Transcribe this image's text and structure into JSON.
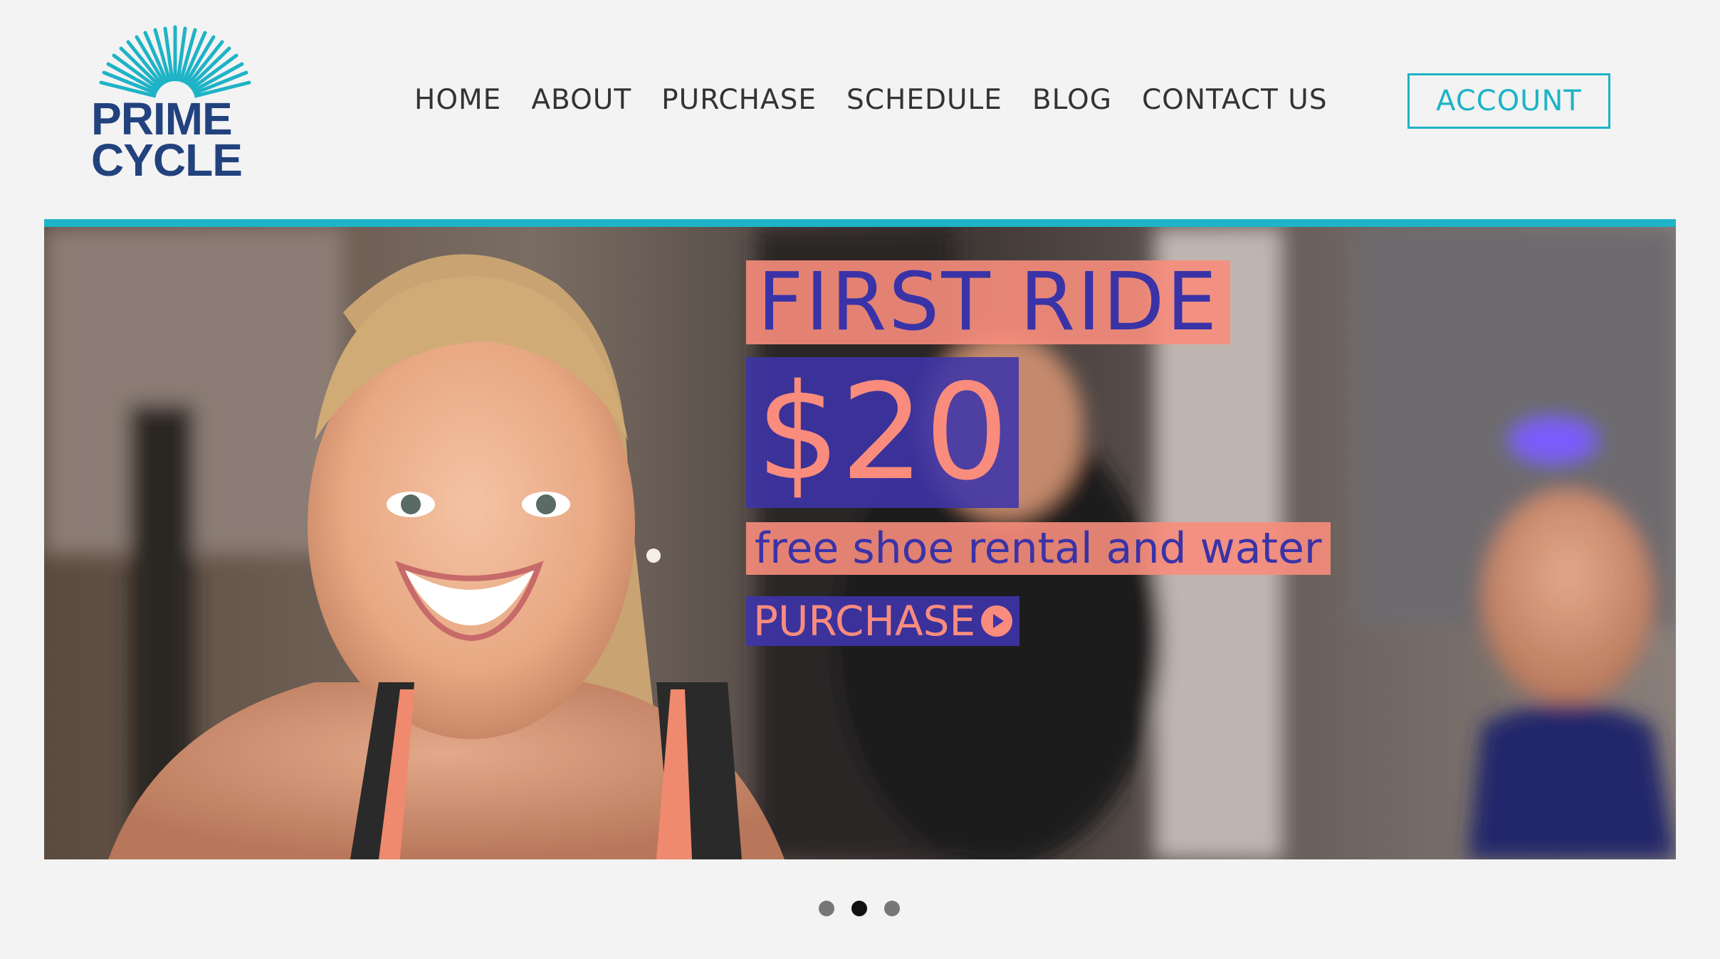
{
  "brand": {
    "logo_line1": "PRIME",
    "logo_line2": "CYCLE",
    "logo_color": "#22427e",
    "accent_color": "#1eb3c6"
  },
  "nav": {
    "items": [
      {
        "label": "HOME"
      },
      {
        "label": "ABOUT"
      },
      {
        "label": "PURCHASE"
      },
      {
        "label": "SCHEDULE"
      },
      {
        "label": "BLOG"
      },
      {
        "label": "CONTACT US"
      }
    ],
    "account_label": "ACCOUNT"
  },
  "hero": {
    "headline": "FIRST RIDE",
    "price": "$20",
    "tagline": "free shoe rental and water",
    "cta_label": "PURCHASE",
    "cta_icon": "play-circle-icon",
    "colors": {
      "coral": "#f98c7d",
      "indigo": "#3a33a8"
    }
  },
  "carousel": {
    "slide_count": 3,
    "active_slide": 2
  }
}
